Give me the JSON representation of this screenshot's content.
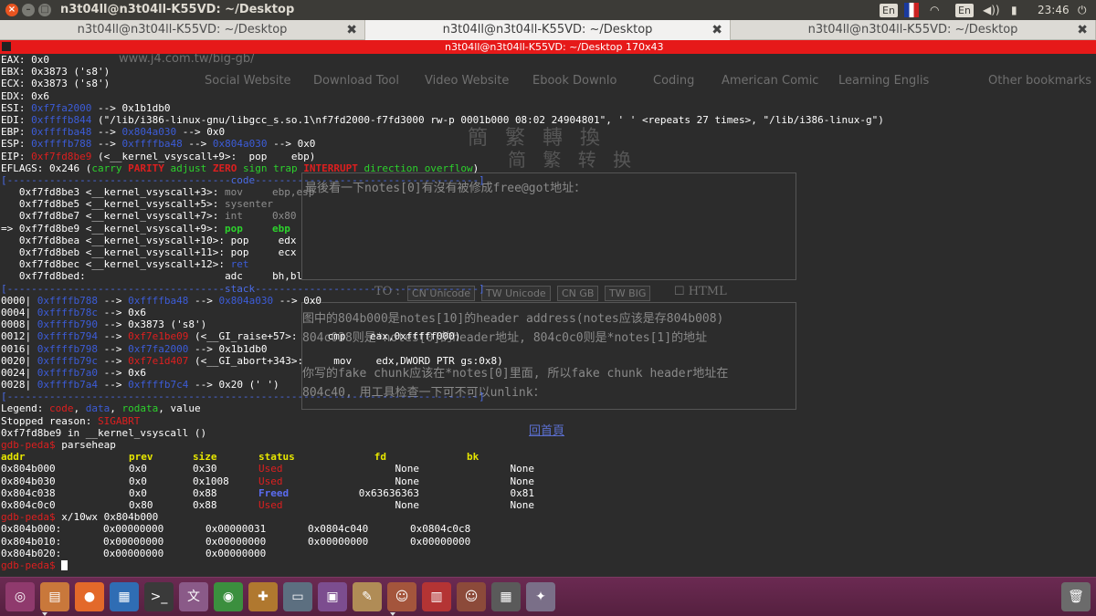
{
  "window": {
    "title": "n3t04ll@n3t04ll-K55VD: ~/Desktop",
    "tray": {
      "lang1": "En",
      "lang2": "En",
      "time": "23:46"
    }
  },
  "tabs": [
    {
      "label": "n3t04ll@n3t04ll-K55VD: ~/Desktop",
      "close": "✖"
    },
    {
      "label": "n3t04ll@n3t04ll-K55VD: ~/Desktop",
      "close": "✖"
    },
    {
      "label": "n3t04ll@n3t04ll-K55VD: ~/Desktop",
      "close": "✖"
    }
  ],
  "terminal_title": "n3t04ll@n3t04ll-K55VD: ~/Desktop 170x43",
  "background_browser": {
    "url": "www.j4.com.tw/big-gb/",
    "bookmarks": [
      "Social Website",
      "Download Tool",
      "Video Website",
      "Ebook Downlo",
      "Coding",
      "American Comic",
      "Learning Englis",
      "Other bookmarks"
    ],
    "logo_trad": "簡 繁 轉 換",
    "logo_simp": "简 繁 转 换",
    "buttons": [
      "CN Unicode",
      "TW Unicode",
      "CN GB",
      "TW BIG"
    ],
    "to_label": "TO :",
    "html_label": "HTML",
    "text_top": "最後看一下notes[0]有沒有被修成free@got地址：",
    "text_lines": [
      "图中的804b000是notes[10]的header address(notes应该是存804b008)",
      "804c038则是*notes[0]的header地址, 804c0c0则是*notes[1]的地址",
      "你写的fake chunk应该在*notes[0]里面, 所以fake chunk header地址在",
      "804c40, 用工具检查一下可不可以unlink："
    ],
    "back_link": "回首頁"
  },
  "registers": {
    "eax": "EAX: 0x0",
    "ebx_name": "EBX: ",
    "ebx_val": "0x3873 ('s8')",
    "ecx_name": "ECX: ",
    "ecx_val": "0x3873 ('s8')",
    "edx": "EDX: 0x6",
    "esi_name": "ESI: ",
    "esi_addr": "0xf7fa2000",
    "esi_rest": " --> 0x1b1db0",
    "edi_name": "EDI: ",
    "edi_addr": "0xffffb844",
    "edi_rest": " (\"/lib/i386-linux-gnu/libgcc_s.so.1\\nf7fd2000-f7fd3000 rw-p 0001b000 08:02 24904801\", ' ' <repeats 27 times>, \"/lib/i386-linux-g\")",
    "ebp_name": "EBP: ",
    "ebp_a1": "0xffffba48",
    "ebp_arrow": " --> ",
    "ebp_a2": "0x804a030",
    "ebp_rest": " --> 0x0",
    "esp_name": "ESP: ",
    "esp_a1": "0xffffb788",
    "esp_a2": "0xffffba48",
    "esp_a3": "0x804a030",
    "esp_rest": " --> 0x0",
    "eip_name": "EIP: ",
    "eip_addr": "0xf7fd8be9",
    "eip_rest": " (<__kernel_vsyscall+9>:  pop    ebp)",
    "eflags_pre": "EFLAGS: 0x246 (",
    "f_carry": "carry",
    "f_parity": "PARITY",
    "f_adjust": "adjust",
    "f_zero": "ZERO",
    "f_sign": "sign",
    "f_trap": "trap",
    "f_interrupt": "INTERRUPT",
    "f_direction": "direction",
    "f_overflow": "overflow",
    "eflags_post": ")"
  },
  "code_section": {
    "header": "[-------------------------------------code-------------------------------------]",
    "lines": [
      {
        "prefix": "   ",
        "addr": "0xf7fd8be3 <__kernel_vsyscall+3>:",
        "op": "mov",
        "args": "ebp,esp",
        "state": "past"
      },
      {
        "prefix": "   ",
        "addr": "0xf7fd8be5 <__kernel_vsyscall+5>:",
        "op": "sysenter",
        "args": "",
        "state": "past"
      },
      {
        "prefix": "   ",
        "addr": "0xf7fd8be7 <__kernel_vsyscall+7>:",
        "op": "int",
        "args": "0x80",
        "state": "past"
      },
      {
        "prefix": "=> ",
        "addr": "0xf7fd8be9 <__kernel_vsyscall+9>:",
        "op": "pop",
        "args": "ebp",
        "state": "current"
      },
      {
        "prefix": "   ",
        "addr": "0xf7fd8bea <__kernel_vsyscall+10>:",
        "op": "pop",
        "args": "edx",
        "state": "next"
      },
      {
        "prefix": "   ",
        "addr": "0xf7fd8beb <__kernel_vsyscall+11>:",
        "op": "pop",
        "args": "ecx",
        "state": "next"
      },
      {
        "prefix": "   ",
        "addr": "0xf7fd8bec <__kernel_vsyscall+12>:",
        "op": "ret",
        "args": "",
        "state": "ret"
      },
      {
        "prefix": "   ",
        "addr": "0xf7fd8bed:",
        "op": "adc",
        "args": "bh,bl",
        "state": "next"
      }
    ]
  },
  "stack_section": {
    "header": "[------------------------------------stack-------------------------------------]",
    "lines": [
      {
        "off": "0000|",
        "a": "0xffffb788",
        "m1": " --> ",
        "b": "0xffffba48",
        "m2": " --> ",
        "c": "0x804a030",
        "rest": " --> 0x0"
      },
      {
        "off": "0004|",
        "a": "0xffffb78c",
        "m1": " --> 0x6",
        "b": "",
        "m2": "",
        "c": "",
        "rest": ""
      },
      {
        "off": "0008|",
        "a": "0xffffb790",
        "m1": " --> 0x3873 ('s8')",
        "b": "",
        "m2": "",
        "c": "",
        "rest": ""
      },
      {
        "off": "0012|",
        "a": "0xffffb794",
        "m1": " --> ",
        "b": "0xf7e1be09",
        "m2": " (<__GI_raise+57>:     cmp    eax,0xfffff000)",
        "c": "",
        "rest": ""
      },
      {
        "off": "0016|",
        "a": "0xffffb798",
        "m1": " --> ",
        "b": "0xf7fa2000",
        "m2": " --> 0x1b1db0",
        "c": "",
        "rest": ""
      },
      {
        "off": "0020|",
        "a": "0xffffb79c",
        "m1": " --> ",
        "b": "0xf7e1d407",
        "m2": " (<__GI_abort+343>:     mov    edx,DWORD PTR gs:0x8)",
        "c": "",
        "rest": ""
      },
      {
        "off": "0024|",
        "a": "0xffffb7a0",
        "m1": " --> 0x6",
        "b": "",
        "m2": "",
        "c": "",
        "rest": ""
      },
      {
        "off": "0028|",
        "a": "0xffffb7a4",
        "m1": " --> ",
        "b": "0xffffb7c4",
        "m2": " --> 0x20 (' ')",
        "c": "",
        "rest": ""
      }
    ],
    "footer": "[------------------------------------------------------------------------------]"
  },
  "legend": {
    "pre": "Legend: ",
    "code": "code",
    "data": "data",
    "rodata": "rodata",
    "value": "value",
    "sep": ", "
  },
  "stopped": {
    "pre": "Stopped reason: ",
    "reason": "SIGABRT"
  },
  "location": "0xf7fd8be9 in __kernel_vsyscall ()",
  "prompt": "gdb-peda$",
  "cmd1": " parseheap",
  "heap_table": {
    "headers": [
      "addr",
      "prev",
      "size",
      "status",
      "fd",
      "bk"
    ],
    "rows": [
      [
        "0x804b000",
        "0x0",
        "0x30",
        "Used",
        "None",
        "None"
      ],
      [
        "0x804b030",
        "0x0",
        "0x1008",
        "Used",
        "None",
        "None"
      ],
      [
        "0x804c038",
        "0x0",
        "0x88",
        "Freed",
        "0x63636363",
        "0x81"
      ],
      [
        "0x804c0c0",
        "0x80",
        "0x88",
        "Used",
        "None",
        "None"
      ]
    ]
  },
  "cmd2": " x/10wx 0x804b000",
  "memdump": [
    {
      "addr": "0x804b000:",
      "w": [
        "0x00000000",
        "0x00000031",
        "0x0804c040",
        "0x0804c0c8"
      ]
    },
    {
      "addr": "0x804b010:",
      "w": [
        "0x00000000",
        "0x00000000",
        "0x00000000",
        "0x00000000"
      ]
    },
    {
      "addr": "0x804b020:",
      "w": [
        "0x00000000",
        "0x00000000",
        "",
        ""
      ]
    }
  ],
  "dock": [
    {
      "name": "ubuntu-dash",
      "glyph": "◎",
      "color": "#8f3a6d"
    },
    {
      "name": "files",
      "glyph": "▤",
      "color": "#c9783b"
    },
    {
      "name": "firefox",
      "glyph": "●",
      "color": "#e3692a"
    },
    {
      "name": "libreoffice-writer",
      "glyph": "▦",
      "color": "#2f6db4"
    },
    {
      "name": "terminal",
      "glyph": ">_",
      "color": "#3a3a3a"
    },
    {
      "name": "unicode-app",
      "glyph": "文",
      "color": "#8a5a88"
    },
    {
      "name": "chrome",
      "glyph": "◉",
      "color": "#3b8f3e"
    },
    {
      "name": "settings",
      "glyph": "✚",
      "color": "#b0782f"
    },
    {
      "name": "remote-desktop",
      "glyph": "▭",
      "color": "#5c6f80"
    },
    {
      "name": "window-manager",
      "glyph": "▣",
      "color": "#7c4d8f"
    },
    {
      "name": "text-editor",
      "glyph": "✎",
      "color": "#b08c56"
    },
    {
      "name": "photo-app-1",
      "glyph": "☺",
      "color": "#a4553c"
    },
    {
      "name": "presentation",
      "glyph": "▥",
      "color": "#b43434"
    },
    {
      "name": "photo-app-2",
      "glyph": "☺",
      "color": "#8c4a3a"
    },
    {
      "name": "workspace-switcher",
      "glyph": "▦",
      "color": "#5a5a5a"
    },
    {
      "name": "screenshot",
      "glyph": "✦",
      "color": "#7a6f88"
    },
    {
      "name": "trash",
      "glyph": "🗑",
      "color": "#6b6b6b"
    }
  ]
}
